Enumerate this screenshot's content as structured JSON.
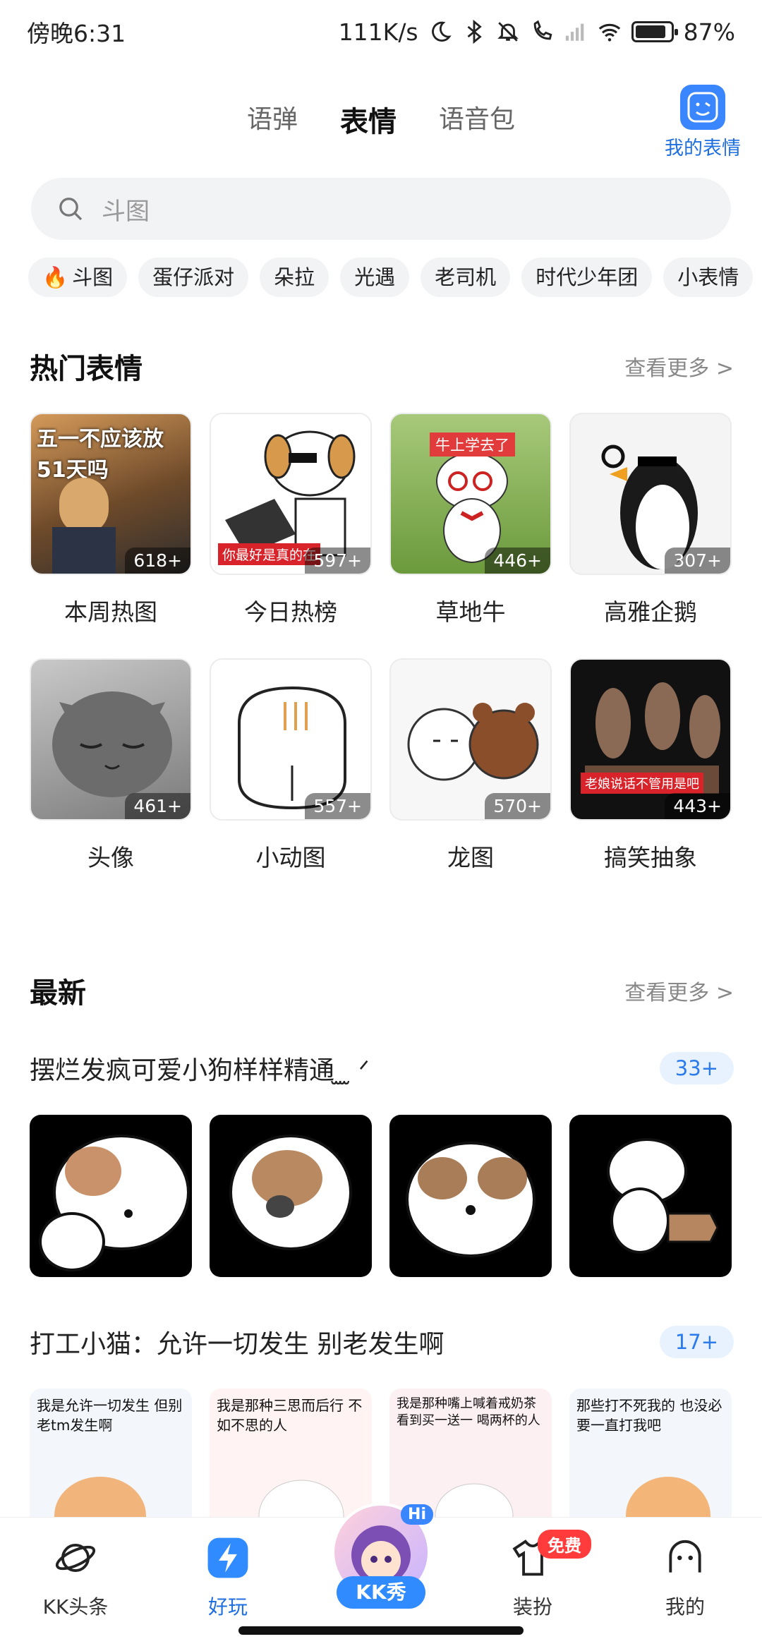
{
  "status": {
    "time": "傍晚6:31",
    "speed": "111K/s",
    "battery": "87%",
    "battery_level": 0.87
  },
  "tabs": [
    {
      "label": "语弹"
    },
    {
      "label": "表情"
    },
    {
      "label": "语音包"
    }
  ],
  "my_expressions": {
    "label": "我的表情"
  },
  "search": {
    "placeholder": "斗图"
  },
  "chips": [
    "斗图",
    "蛋仔派对",
    "朵拉",
    "光遇",
    "老司机",
    "时代少年团",
    "小表情"
  ],
  "hot": {
    "title": "热门表情",
    "more": "查看更多 >",
    "items": [
      {
        "label": "本周热图",
        "count": "618+",
        "overlay": "五一不应该放 51天吗"
      },
      {
        "label": "今日热榜",
        "count": "597+",
        "overlay": "你最好是真的在"
      },
      {
        "label": "草地牛",
        "count": "446+",
        "overlay": "牛上学去了"
      },
      {
        "label": "高雅企鹅",
        "count": "307+",
        "overlay": ""
      },
      {
        "label": "头像",
        "count": "461+",
        "overlay": ""
      },
      {
        "label": "小动图",
        "count": "557+",
        "overlay": ""
      },
      {
        "label": "龙图",
        "count": "570+",
        "overlay": ""
      },
      {
        "label": "搞笑抽象",
        "count": "443+",
        "overlay": "老娘说话不管用是吧"
      }
    ]
  },
  "latest": {
    "title": "最新",
    "more": "查看更多 >",
    "packs": [
      {
        "name": "摆烂发疯可爱小狗样样精通 ̫ ̫ ᐟ",
        "count": "33+"
      },
      {
        "name": "打工小猫：允许一切发生 别老发生啊",
        "count": "17+",
        "captions": [
          "我是允许一切发生 但别老tm发生啊",
          "我是那种三思而后行 不如不思的人",
          "我是那种嘴上喊着戒奶茶 看到买一送一 喝两杯的人",
          "那些打不死我的 也没必要一直打我吧"
        ]
      }
    ]
  },
  "nav": {
    "items": [
      "KK头条",
      "好玩",
      "KK秀",
      "装扮",
      "我的"
    ],
    "free_badge": "免费",
    "hi_badge": "Hi"
  }
}
